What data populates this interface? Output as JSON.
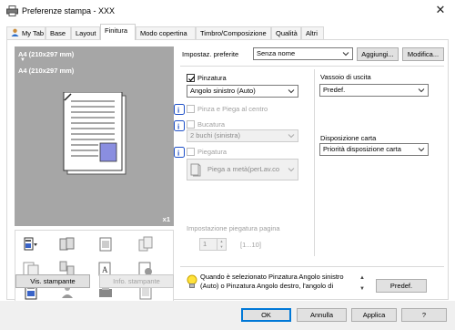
{
  "window": {
    "title": "Preferenze stampa - XXX",
    "close_glyph": "✕"
  },
  "tabs": [
    {
      "label": "My Tab"
    },
    {
      "label": "Base"
    },
    {
      "label": "Layout"
    },
    {
      "label": "Finitura"
    },
    {
      "label": "Modo copertina"
    },
    {
      "label": "Timbro/Composizione"
    },
    {
      "label": "Qualità"
    },
    {
      "label": "Altri"
    }
  ],
  "active_tab": "Finitura",
  "preview": {
    "paper_top": "A4 (210x297 mm)",
    "arrow": "▼",
    "paper_bottom": "A4 (210x297 mm)",
    "copies": "x1"
  },
  "left_buttons": {
    "vis_stampante": "Vis. stampante",
    "info_stampante": "Info. stampante"
  },
  "favorite": {
    "label": "Impostaz. preferite",
    "value": "Senza nome",
    "add_button": "Aggiungi...",
    "edit_button": "Modifica..."
  },
  "finishing": {
    "pinzatura_label": "Pinzatura",
    "pinzatura_checked": true,
    "pinzatura_value": "Angolo sinistro (Auto)",
    "pinza_piega_label": "Pinza e Piega al centro",
    "bucatura_label": "Bucatura",
    "bucatura_value": "2 buchi (sinistra)",
    "piegatura_label": "Piegatura",
    "piegatura_value": "Piega a metà(perLav.co"
  },
  "output": {
    "vassoio_label": "Vassoio di uscita",
    "vassoio_value": "Predef.",
    "disposizione_label": "Disposizione carta",
    "disposizione_value": "Priorità disposizione carta"
  },
  "fold_setting": {
    "label": "Impostazione piegatura pagina",
    "value": "1",
    "range": "[1...10]"
  },
  "tip": {
    "text": "Quando è selezionato Pinzatura Angolo sinistro (Auto) o Pinzatura Angolo destro, l'angolo di",
    "default_button": "Predef."
  },
  "dialog_buttons": {
    "ok": "OK",
    "cancel": "Annulla",
    "apply": "Applica",
    "help": "?"
  },
  "colors": {
    "accent": "#0078d7",
    "preview_bg": "#a6a6a6",
    "info_blue": "#1e50c8"
  }
}
